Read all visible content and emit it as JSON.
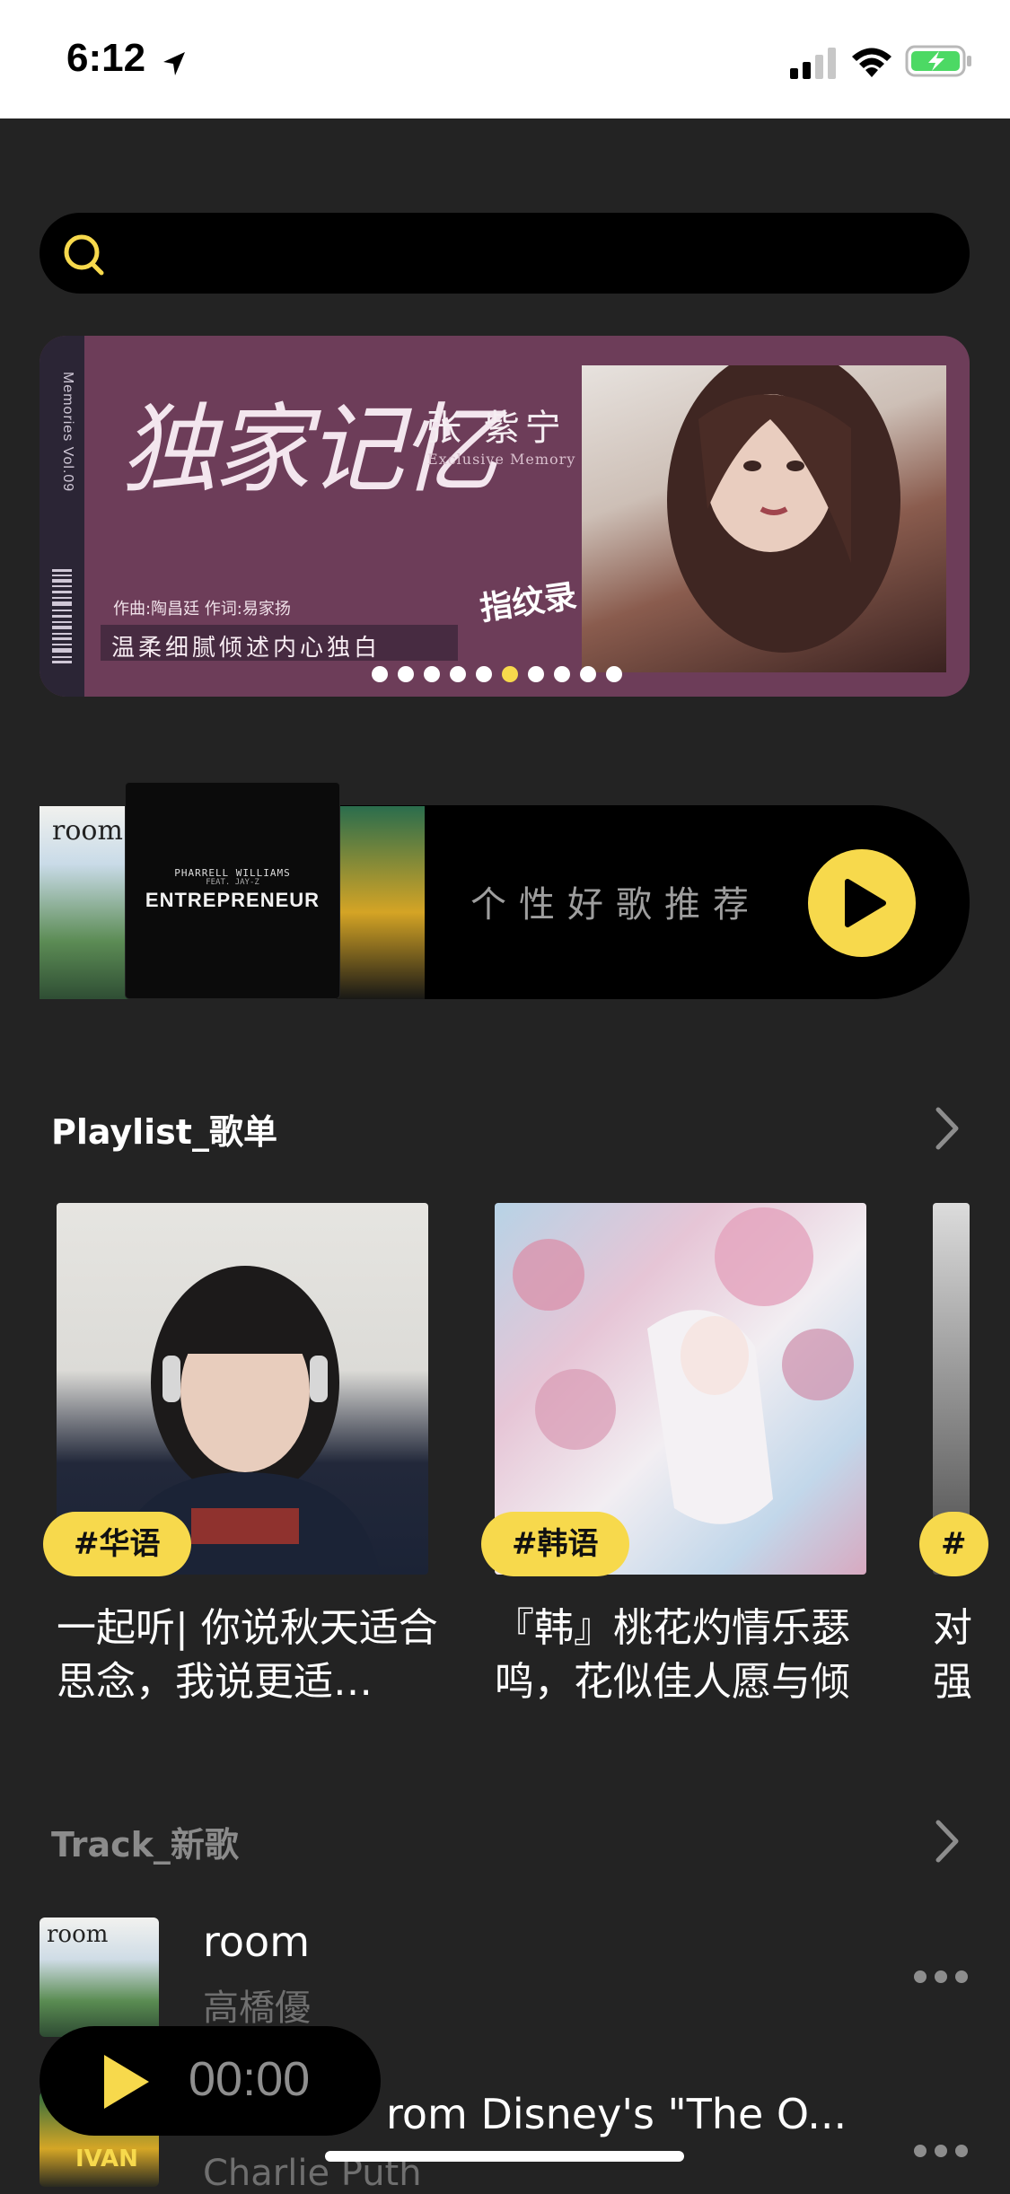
{
  "status_bar": {
    "time": "6:12"
  },
  "search": {
    "placeholder": ""
  },
  "banner": {
    "title": "独家记忆",
    "artist": "张 紫宁",
    "subtitle": "Exclusive Memory",
    "credits": "作曲:陶昌廷  作词:易家扬",
    "tagline": "温柔细腻倾述内心独白",
    "side_text": "Memories  Vol.09",
    "stamp": "指纹录",
    "page_count": 10,
    "active_page": 6
  },
  "recommend": {
    "label": "个性好歌推荐",
    "cover_a_text": "room",
    "cover_b_line1": "PHARRELL WILLIAMS",
    "cover_b_line2": "FEAT. JAY-Z",
    "cover_b_title": "ENTREPRENEUR"
  },
  "playlist_section": {
    "title": "Playlist_歌单",
    "cards": [
      {
        "tag": "#华语",
        "text": "一起听| 你说秋天适合思念，我说更适…"
      },
      {
        "tag": "#韩语",
        "text": "『韩』桃花灼情乐瑟鸣，花似佳人愿与倾"
      },
      {
        "tag": "#",
        "text": "对强"
      }
    ]
  },
  "track_section": {
    "title": "Track_新歌",
    "tracks": [
      {
        "title": "room",
        "artist": "高橋優",
        "thumb_text": "room"
      },
      {
        "title": "rom Disney's \"The O...",
        "artist": "Charlie Puth",
        "thumb_text": "IVAN"
      }
    ]
  },
  "mini_player": {
    "time": "00:00"
  },
  "colors": {
    "accent": "#f7d94c",
    "background": "#232323",
    "pill": "#000000"
  }
}
